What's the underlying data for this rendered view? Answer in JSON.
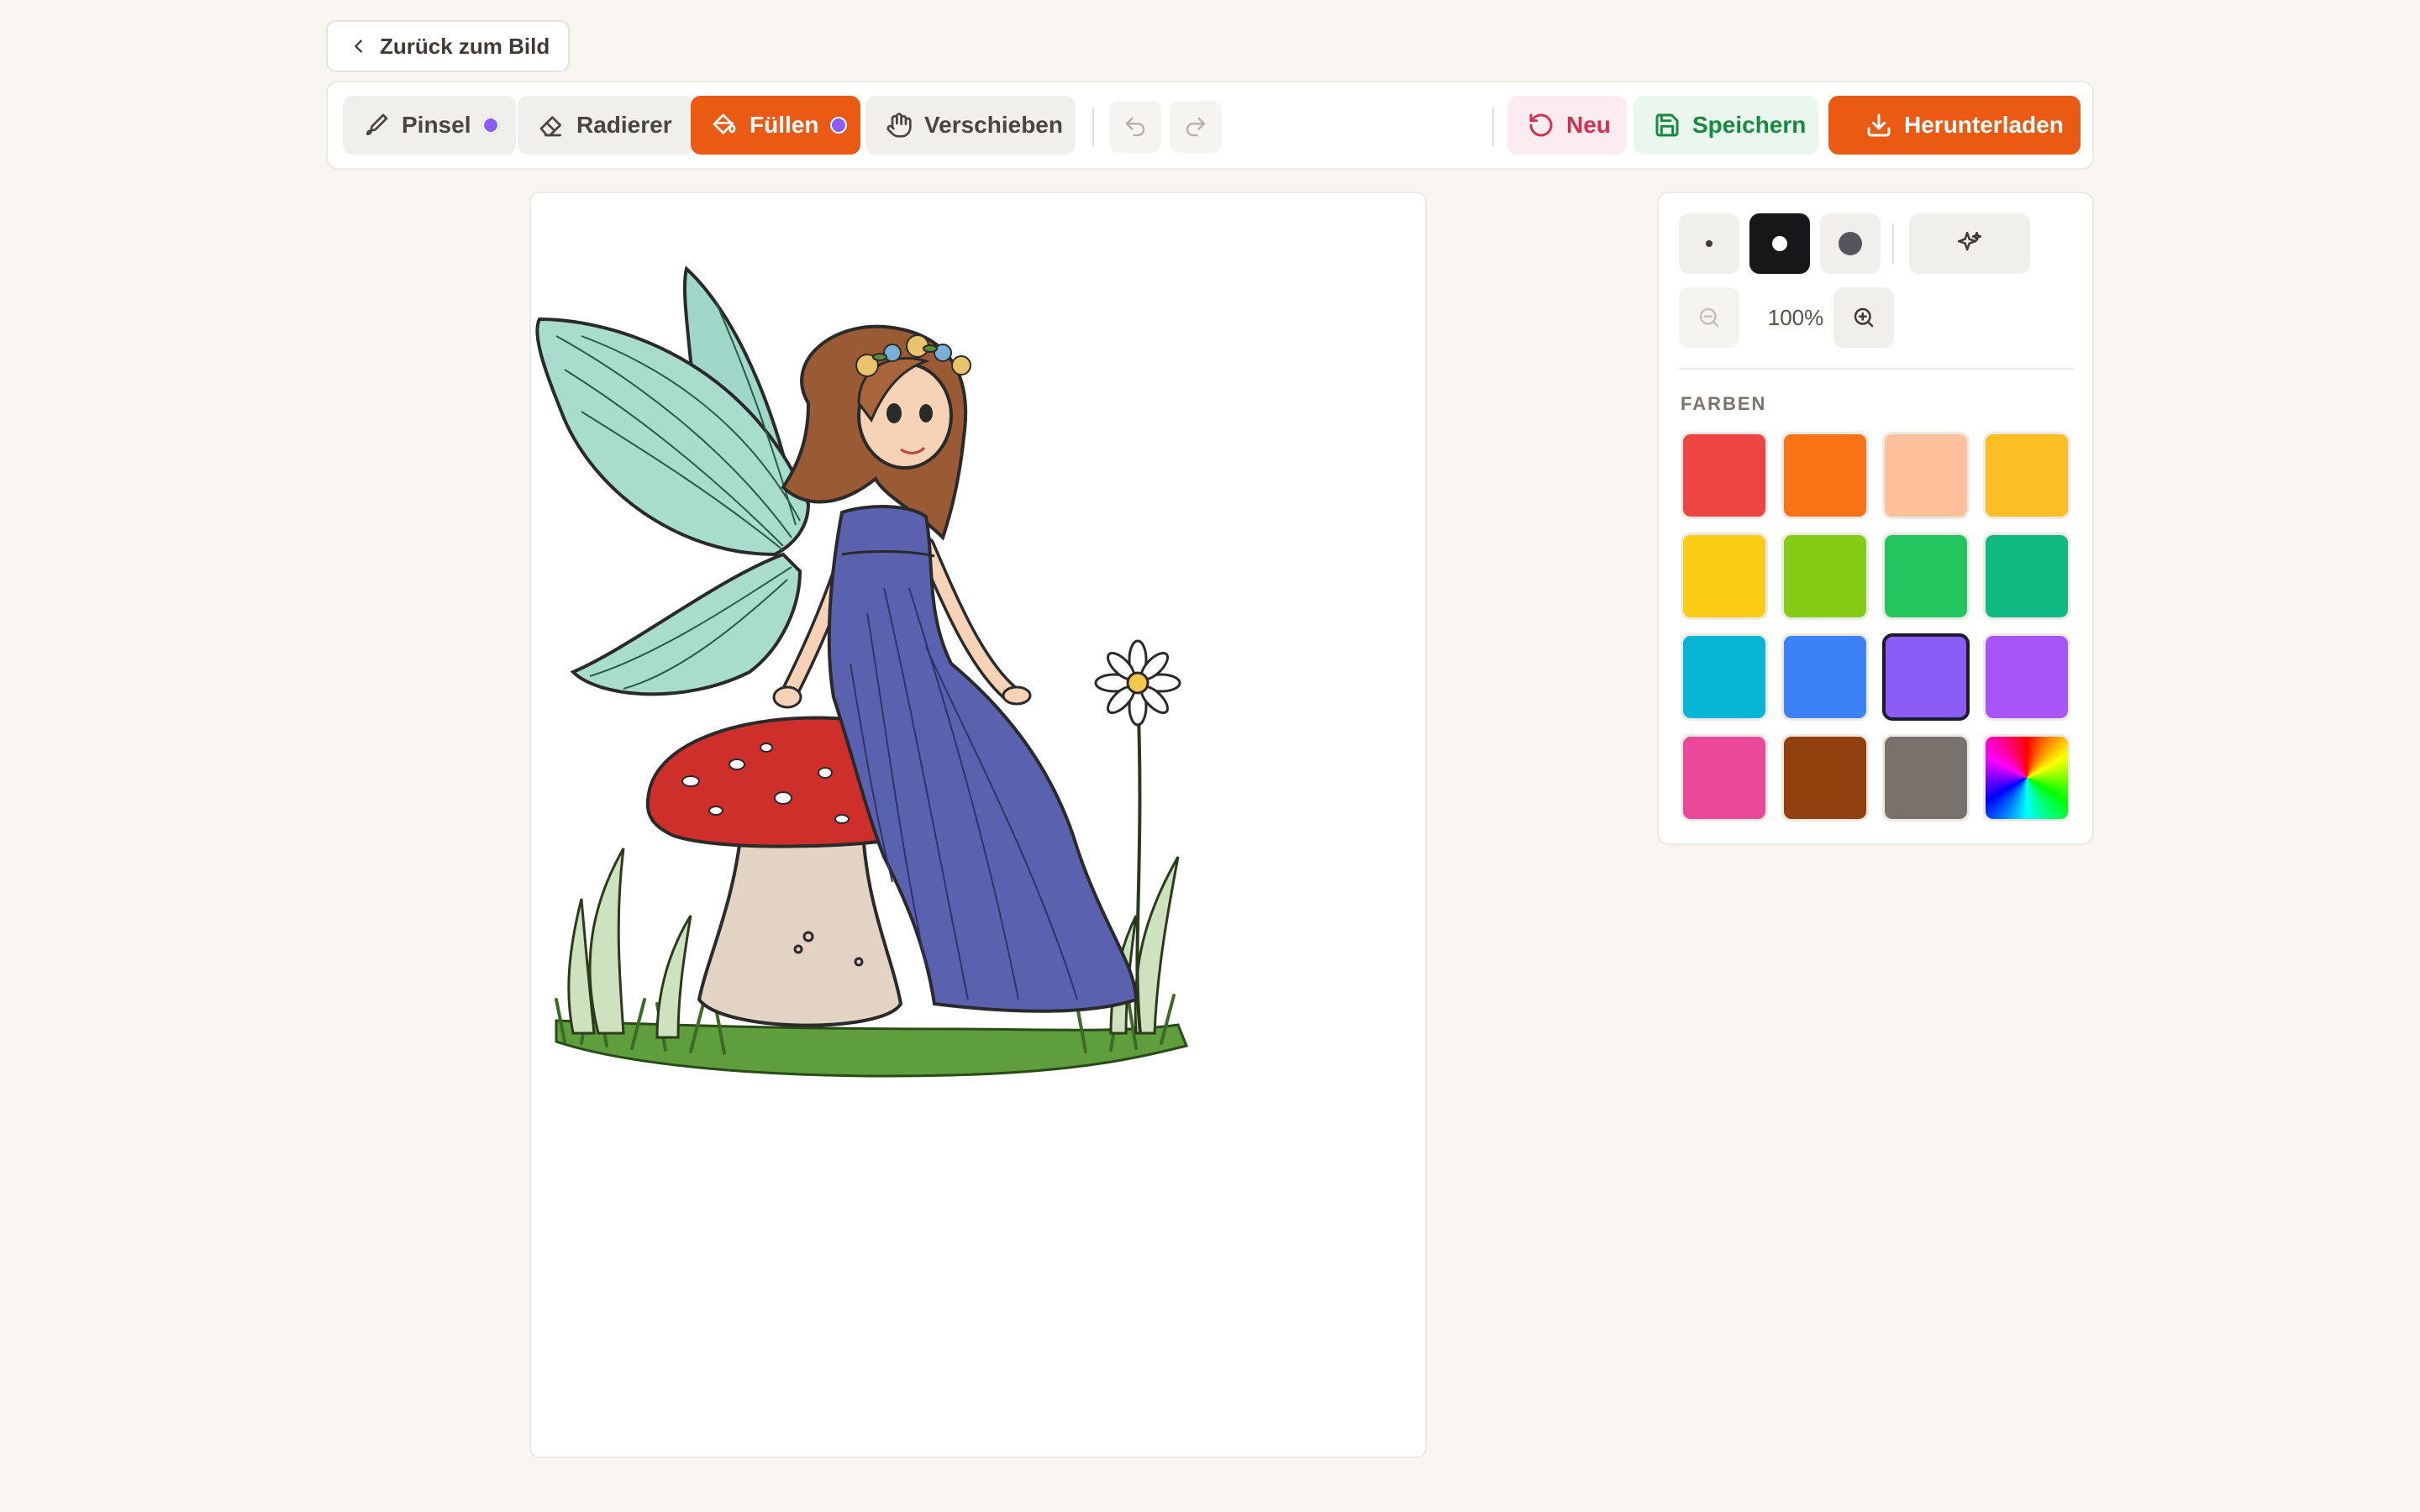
{
  "back_button": {
    "label": "Zurück zum Bild"
  },
  "toolbar": {
    "tools": [
      {
        "id": "brush",
        "label": "Pinsel",
        "icon": "brush-icon",
        "has_color_dot": true,
        "active": false
      },
      {
        "id": "eraser",
        "label": "Radierer",
        "icon": "eraser-icon",
        "has_color_dot": false,
        "active": false
      },
      {
        "id": "fill",
        "label": "Füllen",
        "icon": "paint-bucket-icon",
        "has_color_dot": true,
        "active": true
      },
      {
        "id": "move",
        "label": "Verschieben",
        "icon": "hand-icon",
        "has_color_dot": false,
        "active": false
      }
    ],
    "undo_icon": "undo-icon",
    "redo_icon": "redo-icon",
    "new_label": "Neu",
    "save_label": "Speichern",
    "download_label": "Herunterladen",
    "active_color": "#8b5cf6",
    "accent_color": "#ea5a12"
  },
  "panel": {
    "brush_sizes": [
      "small",
      "medium",
      "large"
    ],
    "selected_brush_size": "medium",
    "magic_icon": "sparkles-icon",
    "zoom_value": "100%",
    "colors_heading": "FARBEN",
    "colors": [
      "#ef4444",
      "#f97316",
      "#fdc09a",
      "#fbbf24",
      "#facc15",
      "#84cc16",
      "#22c55e",
      "#10b981",
      "#06b6d4",
      "#3b82f6",
      "#8b5cf6",
      "#a855f7",
      "#ec4899",
      "#92400e",
      "#78716c",
      "rainbow"
    ],
    "selected_color": "#8b5cf6"
  },
  "canvas": {
    "image_subject": "fairy-on-mushroom-coloring-page"
  }
}
